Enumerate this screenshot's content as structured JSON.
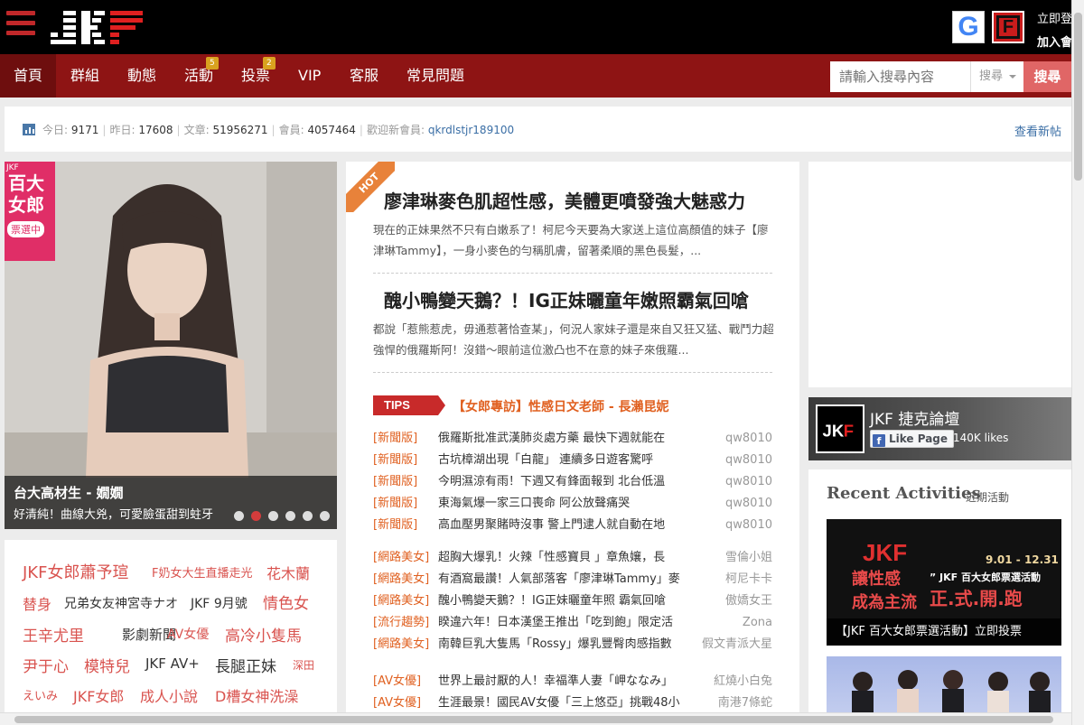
{
  "header": {
    "logo_text": "JKF",
    "google_label": "G",
    "fb_label": "F",
    "login": "立即登",
    "join": "加入會"
  },
  "nav": {
    "items": [
      {
        "label": "首頁",
        "active": true
      },
      {
        "label": "群組"
      },
      {
        "label": "動態"
      },
      {
        "label": "活動",
        "badge": "5"
      },
      {
        "label": "投票",
        "badge": "2"
      },
      {
        "label": "VIP"
      },
      {
        "label": "客服"
      },
      {
        "label": "常見問題"
      }
    ],
    "search_placeholder": "請輸入搜尋內容",
    "search_select": "搜尋",
    "search_button": "搜尋"
  },
  "stats": {
    "today_label": "今日:",
    "today_value": "9171",
    "yesterday_label": "昨日:",
    "yesterday_value": "17608",
    "posts_label": "文章:",
    "posts_value": "51956271",
    "members_label": "會員:",
    "members_value": "4057464",
    "welcome_label": "歡迎新會員:",
    "welcome_member": "qkrdlstjr189100",
    "new_posts_link": "查看新帖"
  },
  "slider": {
    "ribbon_small": "JKF",
    "ribbon_big": "百大女郎",
    "ribbon_tag": "票選中",
    "title": "台大高材生 - 嫺嫺",
    "subtitle": "好清純！曲線大兇，可愛臉蛋甜到蛀牙",
    "dots": 6,
    "active_dot": 1
  },
  "tags": [
    {
      "text": "JKF女郎蕭予瑄",
      "size": 18,
      "color": "#d9534f"
    },
    {
      "text": "F奶女大生直播走光",
      "size": 13,
      "color": "#d9534f"
    },
    {
      "text": "花木蘭",
      "size": 16,
      "color": "#d9534f"
    },
    {
      "text": "替身",
      "size": 16,
      "color": "#d9534f"
    },
    {
      "text": "兄弟女友神宮寺ナオ",
      "size": 14,
      "color": "#333333"
    },
    {
      "text": "JKF 9月號",
      "size": 14,
      "color": "#333333"
    },
    {
      "text": "情色女",
      "size": 17,
      "color": "#d9534f"
    },
    {
      "text": "王辛尤里",
      "size": 17,
      "color": "#d9534f"
    },
    {
      "text": "影劇新聞",
      "size": 15,
      "color": "#333333"
    },
    {
      "text": "AV女優",
      "size": 14,
      "color": "#d9534f"
    },
    {
      "text": "高冷小隻馬",
      "size": 17,
      "color": "#d9534f"
    },
    {
      "text": "尹于心",
      "size": 17,
      "color": "#d9534f"
    },
    {
      "text": "模特兒",
      "size": 17,
      "color": "#d9534f"
    },
    {
      "text": "JKF AV+",
      "size": 15,
      "color": "#333333"
    },
    {
      "text": "長腿正妹",
      "size": 17,
      "color": "#333333"
    },
    {
      "text": "深田",
      "size": 12,
      "color": "#d9534f"
    },
    {
      "text": "えいみ",
      "size": 13,
      "color": "#d9534f"
    },
    {
      "text": "JKF女郎",
      "size": 16,
      "color": "#d9534f"
    },
    {
      "text": "成人小說",
      "size": 16,
      "color": "#d9534f"
    },
    {
      "text": "D槽女神洗澡",
      "size": 16,
      "color": "#d9534f"
    }
  ],
  "hot": {
    "ribbon": "HOT",
    "articles": [
      {
        "title": "廖津琳麥色肌超性感，美體更噴發強大魅惑力",
        "desc": "現在的正妹果然不只有白嫩系了！柯尼今天要為大家送上這位高顏值的妹子【廖津琳Tammy】，一身小麥色的勻稱肌膚，留著柔順的黑色長髮，..."
      },
      {
        "title": "醜小鴨變天鵝？！IG正妹曬童年嫩照霸氣回嗆",
        "desc": "都說「惹熊惹虎，毋通惹著恰查某」，何況人家妹子還是來自又狂又猛、戰鬥力超強悍的俄羅斯阿！沒錯～眼前這位激凸也不在意的妹子來俄羅..."
      }
    ],
    "tips_label": "TIPS",
    "tips_title": "【女郎專訪】性感日文老師 - 長瀨昆妮"
  },
  "news_groups": [
    [
      {
        "cat": "[新聞版]",
        "title": "俄羅斯批准武漢肺炎處方藥 最快下週就能在",
        "author": "qw8010"
      },
      {
        "cat": "[新聞版]",
        "title": "古坑樟湖出現「白龍」 連續多日遊客驚呼",
        "author": "qw8010"
      },
      {
        "cat": "[新聞版]",
        "title": "今明濕涼有雨！下週又有鋒面報到 北台低溫",
        "author": "qw8010"
      },
      {
        "cat": "[新聞版]",
        "title": "東海氣爆一家三口喪命 阿公放聲痛哭",
        "author": "qw8010"
      },
      {
        "cat": "[新聞版]",
        "title": "高血壓男聚賭時沒事 警上門逮人就自動在地",
        "author": "qw8010"
      }
    ],
    [
      {
        "cat": "[網路美女]",
        "title": "超胸大爆乳！火辣「性感寶貝 」章魚孃，長",
        "author": "雪倫小姐"
      },
      {
        "cat": "[網路美女]",
        "title": "有酒窩最讚！人氣部落客「廖津琳Tammy」麥",
        "author": "柯尼卡卡"
      },
      {
        "cat": "[網路美女]",
        "title": "醜小鴨變天鵝？！IG正妹曬童年照 霸氣回嗆",
        "author": "傲嬌女王"
      },
      {
        "cat": "[流行趨勢]",
        "title": "睽違六年！日本漢堡王推出「吃到飽」限定活",
        "author": "Zona"
      },
      {
        "cat": "[網路美女]",
        "title": "南韓巨乳大隻馬「Rossy」爆乳豐臀肉感指數",
        "author": "假文青派大星"
      }
    ],
    [
      {
        "cat": "[AV女優]",
        "title": "世界上最討厭的人！幸福準人妻「岬ななみ」",
        "author": "紅燒小白兔"
      },
      {
        "cat": "[AV女優]",
        "title": "生涯最景！國民AV女優「三上悠亞」挑戰48小",
        "author": "南港7條蛇"
      }
    ]
  ],
  "facebook": {
    "page_name": "JKF 捷克論壇",
    "like_button": "Like Page",
    "likes": "140K likes"
  },
  "recent": {
    "title": "Recent Activities",
    "subtitle": "近期活動",
    "banner_logo": "JKF",
    "banner_date": "9.01 - 12.31",
    "banner_line1": "讓性感",
    "banner_line1b": "” JKF 百大女郎票選活動",
    "banner_line2": "成為主流",
    "banner_line2b": "正.式.開.跑",
    "caption": "【JKF 百大女郎票選活動】立即投票"
  }
}
